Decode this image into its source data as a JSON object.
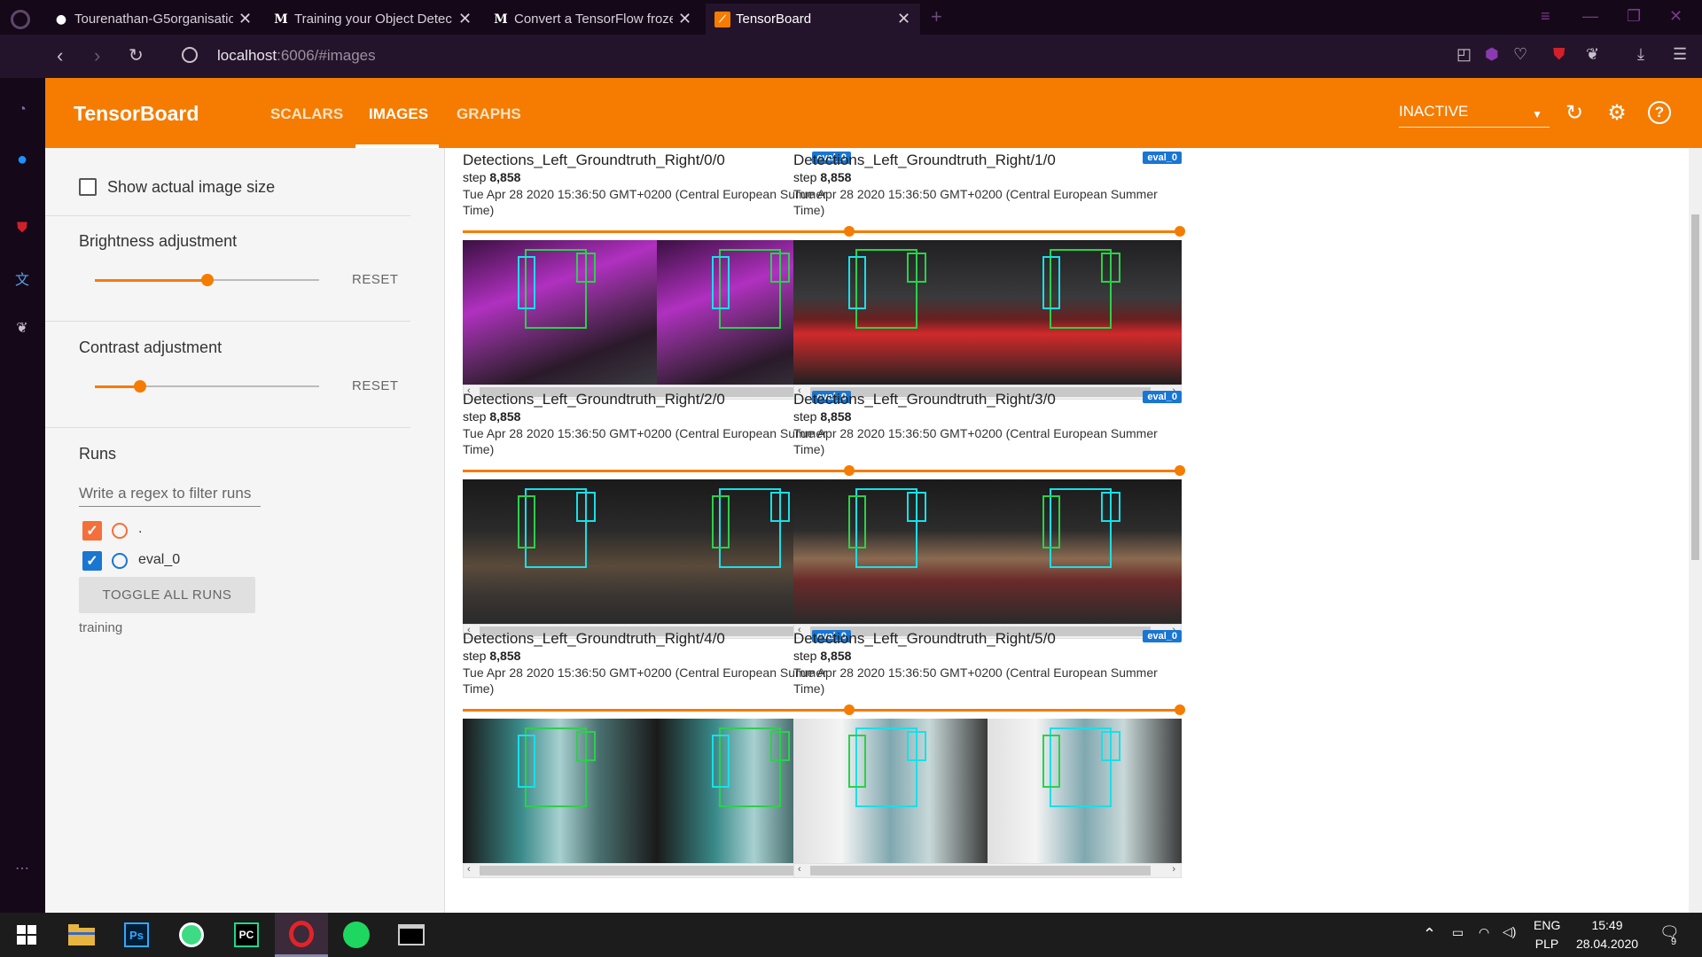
{
  "browser": {
    "tabs": [
      {
        "favicon": "github-icon",
        "title": "Tourenathan-G5organisatio"
      },
      {
        "favicon": "M",
        "title": "Training your Object Detec"
      },
      {
        "favicon": "M",
        "title": "Convert a TensorFlow froze"
      },
      {
        "favicon": "tensorboard-icon",
        "title": "TensorBoard"
      }
    ],
    "url_host": "localhost",
    "url_rest": ":6006/#images"
  },
  "tensorboard": {
    "brand": "TensorBoard",
    "tabs": [
      "SCALARS",
      "IMAGES",
      "GRAPHS"
    ],
    "active_tab": "IMAGES",
    "reload_status": "INACTIVE",
    "accent": "#f57c00"
  },
  "sidebar": {
    "show_actual_size_label": "Show actual image size",
    "brightness_label": "Brightness adjustment",
    "brightness_value": 0.5,
    "contrast_label": "Contrast adjustment",
    "contrast_value": 0.2,
    "reset_label": "RESET",
    "runs_label": "Runs",
    "regex_placeholder": "Write a regex to filter runs",
    "runs": [
      {
        "name": ".",
        "color": "#f4703a",
        "checked": true
      },
      {
        "name": "eval_0",
        "color": "#1976d2",
        "checked": true
      }
    ],
    "toggle_all_label": "TOGGLE ALL RUNS",
    "logdir": "training"
  },
  "cards": [
    {
      "name": "Detections_Left_Groundtruth_Right/0/0",
      "run": "eval_0",
      "step_label": "step",
      "step": "8,858",
      "time": "Tue Apr 28 2020 15:36:50 GMT+0200 (Central European Summer Time)",
      "scene": "purple"
    },
    {
      "name": "Detections_Left_Groundtruth_Right/1/0",
      "run": "eval_0",
      "step_label": "step",
      "step": "8,858",
      "time": "Tue Apr 28 2020 15:36:50 GMT+0200 (Central European Summer Time)",
      "scene": "red"
    },
    {
      "name": "Detections_Left_Groundtruth_Right/2/0",
      "run": "eval_0",
      "step_label": "step",
      "step": "8,858",
      "time": "Tue Apr 28 2020 15:36:50 GMT+0200 (Central European Summer Time)",
      "scene": "hall"
    },
    {
      "name": "Detections_Left_Groundtruth_Right/3/0",
      "run": "eval_0",
      "step_label": "step",
      "step": "8,858",
      "time": "Tue Apr 28 2020 15:36:50 GMT+0200 (Central European Summer Time)",
      "scene": "hall-red"
    },
    {
      "name": "Detections_Left_Groundtruth_Right/4/0",
      "run": "eval_0",
      "step_label": "step",
      "step": "8,858",
      "time": "Tue Apr 28 2020 15:36:50 GMT+0200 (Central European Summer Time)",
      "scene": "teal"
    },
    {
      "name": "Detections_Left_Groundtruth_Right/5/0",
      "run": "eval_0",
      "step_label": "step",
      "step": "8,858",
      "time": "Tue Apr 28 2020 15:36:50 GMT+0200 (Central European Summer Time)",
      "scene": "white"
    }
  ],
  "taskbar": {
    "lang": "ENG",
    "layout": "PLP",
    "time": "15:49",
    "date": "28.04.2020",
    "notifications": "9"
  }
}
